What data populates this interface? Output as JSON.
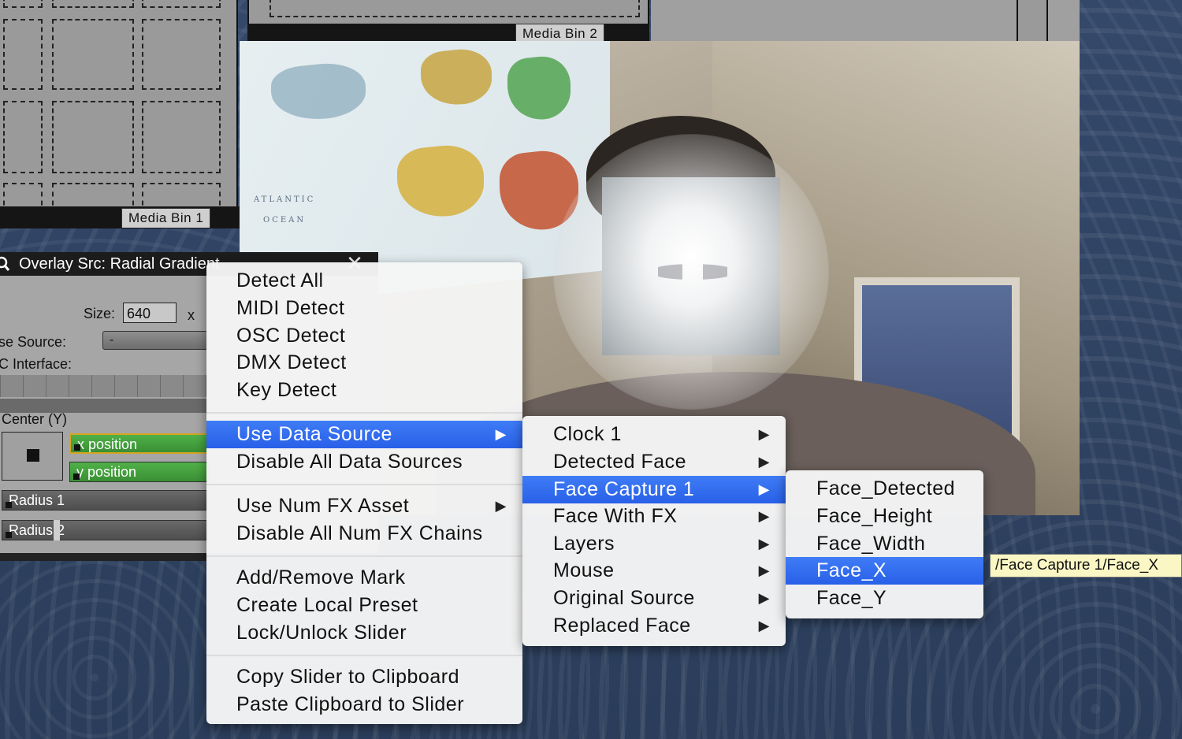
{
  "media_bins": {
    "bin1_label": "Media Bin 1",
    "bin2_label": "Media Bin 2"
  },
  "video": {
    "map_text_line1": "ATLANTIC",
    "map_text_line2": "OCEAN"
  },
  "inspector": {
    "title": "Overlay Src: Radial Gradient",
    "size_label": "Size:",
    "size_value": "640",
    "size_x": "x",
    "source_label": "se Source:",
    "source_value": "-",
    "interface_label": "C Interface:",
    "center_label": "Center (Y)",
    "x_slider_label": "x position",
    "y_slider_label": "y position",
    "radius1_label": "Radius 1",
    "radius2_label": "Radius 2"
  },
  "context_menu": {
    "items": [
      {
        "label": "Detect All"
      },
      {
        "label": "MIDI Detect"
      },
      {
        "label": "OSC Detect"
      },
      {
        "label": "DMX Detect"
      },
      {
        "label": "Key Detect"
      },
      {
        "label": "Use Data Source",
        "submenu": true,
        "selected": true
      },
      {
        "label": "Disable All Data Sources"
      },
      {
        "label": "Use Num FX Asset",
        "submenu": true
      },
      {
        "label": "Disable All Num FX Chains"
      },
      {
        "label": "Add/Remove Mark"
      },
      {
        "label": "Create Local Preset"
      },
      {
        "label": "Lock/Unlock Slider"
      },
      {
        "label": "Copy Slider to Clipboard"
      },
      {
        "label": "Paste Clipboard to Slider"
      }
    ]
  },
  "data_source_menu": {
    "items": [
      {
        "label": "Clock 1",
        "submenu": true
      },
      {
        "label": "Detected Face",
        "submenu": true
      },
      {
        "label": "Face Capture 1",
        "submenu": true,
        "selected": true
      },
      {
        "label": "Face With FX",
        "submenu": true
      },
      {
        "label": "Layers",
        "submenu": true
      },
      {
        "label": "Mouse",
        "submenu": true
      },
      {
        "label": "Original Source",
        "submenu": true
      },
      {
        "label": "Replaced Face",
        "submenu": true
      }
    ]
  },
  "face_capture_menu": {
    "items": [
      {
        "label": "Face_Detected"
      },
      {
        "label": "Face_Height"
      },
      {
        "label": "Face_Width"
      },
      {
        "label": "Face_X",
        "selected": true
      },
      {
        "label": "Face_Y"
      }
    ]
  },
  "tooltip": {
    "text": "/Face Capture 1/Face_X"
  },
  "icons": {
    "submenu_arrow": "▶",
    "close": "✕",
    "magnifier": "🔍"
  },
  "colors": {
    "menu_highlight": "#2f6cf0",
    "slider_green": "#47a33f",
    "tooltip_bg": "#fbf7c4"
  }
}
